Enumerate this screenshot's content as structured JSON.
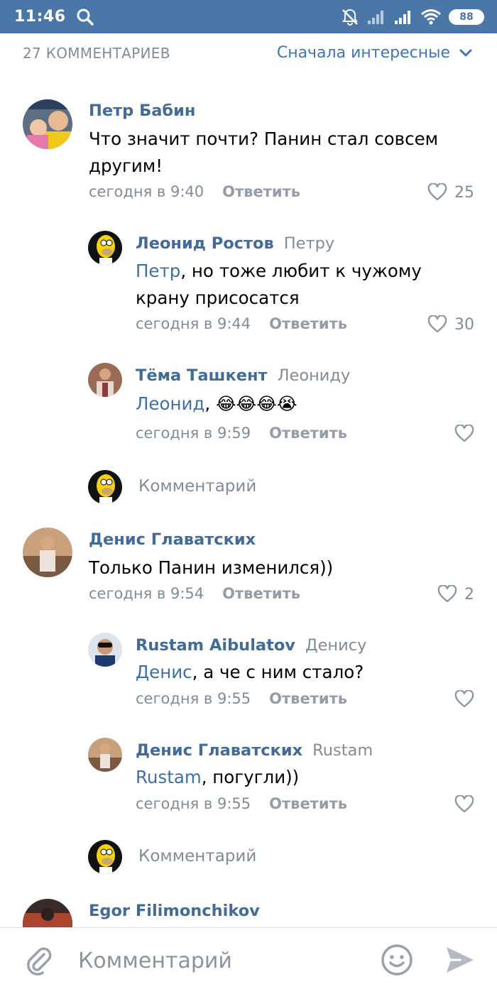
{
  "status": {
    "time": "11:46",
    "battery": "88",
    "icons": [
      "search-icon",
      "notifications-muted-icon",
      "signal-icon",
      "signal-icon",
      "wifi-icon",
      "battery-icon"
    ]
  },
  "header": {
    "count": "27 КОММЕНТАРИЕВ",
    "sort_label": "Сначала интересные"
  },
  "comments": [
    {
      "author": "Петр Бабин",
      "text": [
        "Что значит почти? Панин стал совсем",
        "другим!"
      ],
      "time": "сегодня в 9:40",
      "reply": "Ответить",
      "likes": "25"
    },
    {
      "author": "Леонид Ростов",
      "reply_to": "Петру",
      "mention": "Петр",
      "text": [
        ", но тоже любит к чужому",
        "крану присосатся"
      ],
      "time": "сегодня в 9:44",
      "reply": "Ответить",
      "likes": "30"
    },
    {
      "author": "Тёма Ташкент",
      "reply_to": "Леониду",
      "mention": "Леонид",
      "text": [
        ", 😂😂😂😭"
      ],
      "time": "сегодня в 9:59",
      "reply": "Ответить",
      "likes": ""
    },
    {
      "author": "Денис Главатских",
      "text": [
        "Только Панин изменился))"
      ],
      "time": "сегодня в 9:54",
      "reply": "Ответить",
      "likes": "2"
    },
    {
      "author": "Rustam Aibulatov",
      "reply_to": "Денису",
      "mention": "Денис",
      "text": [
        ", а че с ним стало?"
      ],
      "time": "сегодня в 9:55",
      "reply": "Ответить",
      "likes": ""
    },
    {
      "author": "Денис Главатских",
      "reply_to": "Rustam",
      "mention": "Rustam",
      "text": [
        ", погугли))"
      ],
      "time": "сегодня в 9:55",
      "reply": "Ответить",
      "likes": ""
    },
    {
      "author": "Egor Filimonchikov"
    }
  ],
  "reply_placeholder": "Комментарий",
  "bottom": {
    "placeholder": "Комментарий"
  },
  "colors": {
    "statusbar": "#4a76a8",
    "link": "#436b97",
    "secondary": "#818c99"
  }
}
